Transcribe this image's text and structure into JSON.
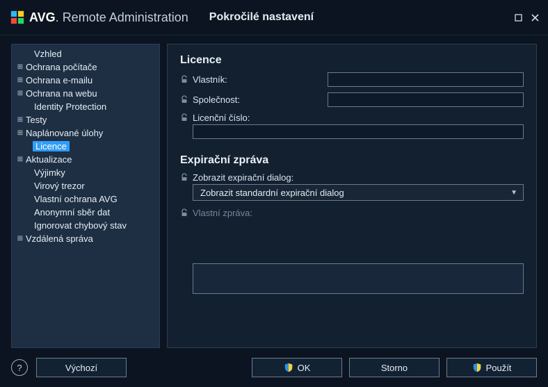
{
  "titlebar": {
    "brand_bold": "AVG",
    "brand_thin": "Remote Administration",
    "subtitle": "Pokročilé nastavení"
  },
  "sidebar": {
    "items": [
      {
        "label": "Vzhled",
        "exp": "",
        "child": true
      },
      {
        "label": "Ochrana počítače",
        "exp": "⊞"
      },
      {
        "label": "Ochrana e-mailu",
        "exp": "⊞"
      },
      {
        "label": "Ochrana na webu",
        "exp": "⊞"
      },
      {
        "label": "Identity Protection",
        "exp": "",
        "child": true
      },
      {
        "label": "Testy",
        "exp": "⊞"
      },
      {
        "label": "Naplánované úlohy",
        "exp": "⊞"
      },
      {
        "label": "Licence",
        "exp": "",
        "child": true,
        "selected": true
      },
      {
        "label": "Aktualizace",
        "exp": "⊞"
      },
      {
        "label": "Výjimky",
        "exp": "",
        "child": true
      },
      {
        "label": "Virový trezor",
        "exp": "",
        "child": true
      },
      {
        "label": "Vlastní ochrana AVG",
        "exp": "",
        "child": true
      },
      {
        "label": "Anonymní sběr dat",
        "exp": "",
        "child": true
      },
      {
        "label": "Ignorovat chybový stav",
        "exp": "",
        "child": true
      },
      {
        "label": "Vzdálená správa",
        "exp": "⊞"
      }
    ]
  },
  "license": {
    "section": "Licence",
    "owner_label": "Vlastník:",
    "owner_value": "",
    "company_label": "Společnost:",
    "company_value": "",
    "number_label": "Licenční číslo:",
    "number_value": ""
  },
  "expiration": {
    "section": "Expirační zpráva",
    "show_label": "Zobrazit expirační dialog:",
    "select_value": "Zobrazit standardní expirační dialog",
    "custom_label": "Vlastní zpráva:",
    "custom_value": ""
  },
  "footer": {
    "default": "Výchozí",
    "ok": "OK",
    "cancel": "Storno",
    "apply": "Použít"
  }
}
